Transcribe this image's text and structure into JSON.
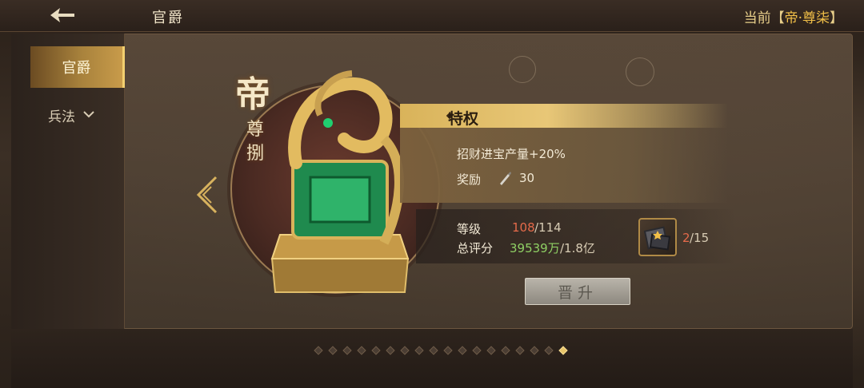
{
  "header": {
    "title": "官爵",
    "rank_prefix": "当前【",
    "rank_value": "帝·尊柒",
    "rank_suffix": "】"
  },
  "sidebar": {
    "items": [
      {
        "label": "官爵",
        "active": true
      },
      {
        "label": "兵法",
        "expandable": true
      }
    ]
  },
  "rank": {
    "glyph": "帝",
    "sub": "尊捌"
  },
  "privilege": {
    "title": "特权",
    "effect": "招财进宝产量+20%",
    "reward_label": "奖励",
    "reward_icon": "quill-icon",
    "reward_value": "30"
  },
  "stats": {
    "level_label": "等级",
    "level_current": "108",
    "level_max": "/114",
    "score_label": "总评分",
    "score_current": "39539万",
    "score_max": "/1.8亿"
  },
  "item": {
    "icon": "token-item-icon",
    "current": "2",
    "required": "/15"
  },
  "promote_button": {
    "label": "晋升",
    "enabled": false
  },
  "pager": {
    "count": 18,
    "active_index": 17
  },
  "colors": {
    "accent_gold": "#e8c777",
    "insufficient": "#e56a4a",
    "score_green": "#8fd064"
  }
}
